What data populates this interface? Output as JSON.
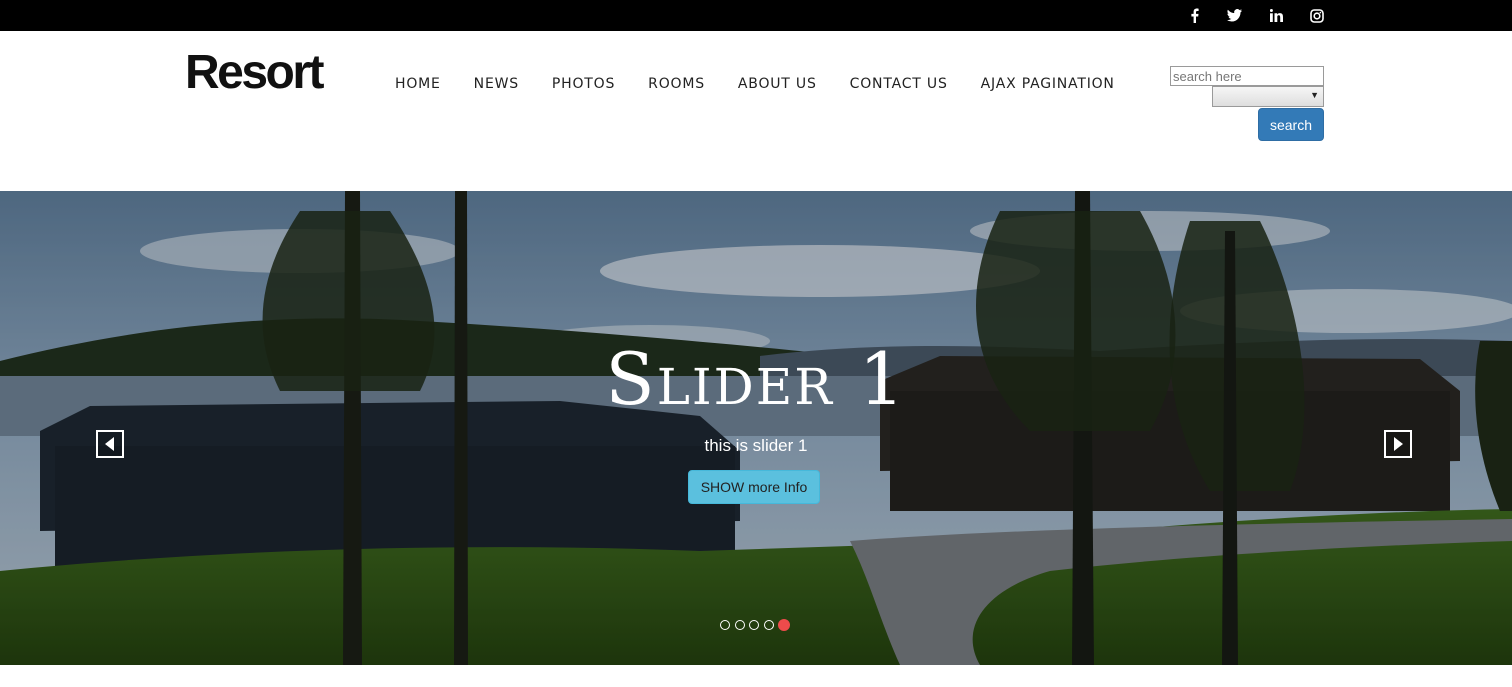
{
  "social": [
    {
      "name": "facebook-icon"
    },
    {
      "name": "twitter-icon"
    },
    {
      "name": "linkedin-icon"
    },
    {
      "name": "instagram-icon"
    }
  ],
  "header": {
    "logo": "Resort",
    "nav": [
      "HOME",
      "NEWS",
      "PHOTOS",
      "ROOMS",
      "ABOUT US",
      "CONTACT US",
      "AJAX PAGINATION"
    ]
  },
  "search": {
    "placeholder": "search here",
    "select_value": "",
    "button_label": "search"
  },
  "slider": {
    "title": "Slider 1",
    "subtitle": "this is slider 1",
    "button_label": "SHOW more Info",
    "dot_count": 5,
    "active_dot": 5
  },
  "colors": {
    "topbar": "#000000",
    "search_button": "#337ab7",
    "info_button": "#5bc0de",
    "active_dot": "#ee4b4b"
  }
}
